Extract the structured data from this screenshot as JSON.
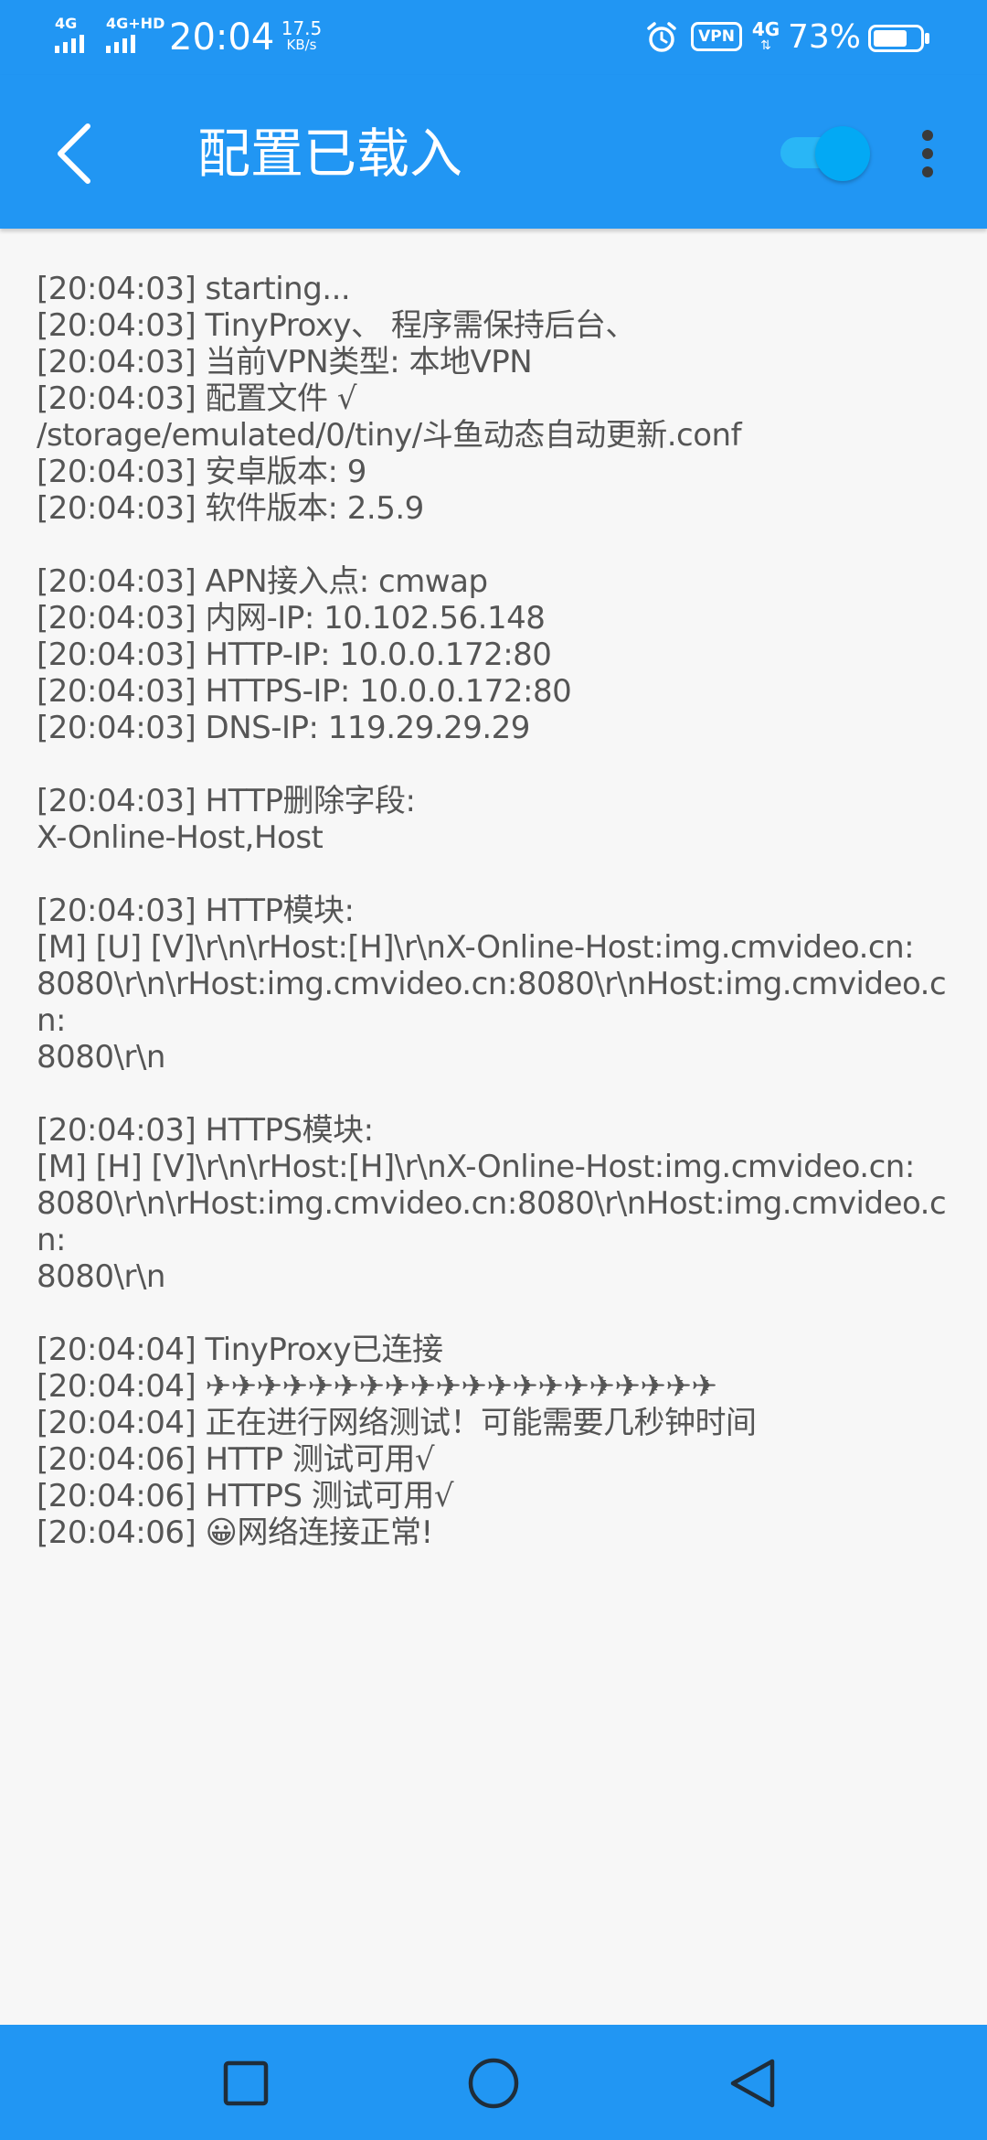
{
  "status_bar": {
    "network_left_1": "4G",
    "network_left_2": "4G+HD",
    "time": "20:04",
    "speed_value": "17.5",
    "speed_unit": "KB/s",
    "vpn_label": "VPN",
    "network_right": "4G",
    "battery_percent": "73%",
    "battery_level": 0.73
  },
  "app_bar": {
    "title": "配置已载入",
    "toggle_on": true
  },
  "log_text": "[20:04:03] starting...\n[20:04:03] TinyProxy、 程序需保持后台、\n[20:04:03] 当前VPN类型: 本地VPN\n[20:04:03] 配置文件 √\n/storage/emulated/0/tiny/斗鱼动态自动更新.conf\n[20:04:03] 安卓版本: 9\n[20:04:03] 软件版本: 2.5.9\n\n[20:04:03] APN接入点: cmwap\n[20:04:03] 内网-IP: 10.102.56.148\n[20:04:03] HTTP-IP: 10.0.0.172:80\n[20:04:03] HTTPS-IP: 10.0.0.172:80\n[20:04:03] DNS-IP: 119.29.29.29\n\n[20:04:03] HTTP删除字段:\nX-Online-Host,Host\n\n[20:04:03] HTTP模块:\n[M] [U] [V]\\r\\n\\rHost:[H]\\r\\nX-Online-Host:img.cmvideo.cn:\n8080\\r\\n\\rHost:img.cmvideo.cn:8080\\r\\nHost:img.cmvideo.cn:\n8080\\r\\n\n\n[20:04:03] HTTPS模块:\n[M] [H] [V]\\r\\n\\rHost:[H]\\r\\nX-Online-Host:img.cmvideo.cn:\n8080\\r\\n\\rHost:img.cmvideo.cn:8080\\r\\nHost:img.cmvideo.cn:\n8080\\r\\n\n\n[20:04:04] TinyProxy已连接\n[20:04:04] ✈✈✈✈✈✈✈✈✈✈✈✈✈✈✈✈✈✈✈✈\n[20:04:04] 正在进行网络测试！可能需要几秒钟时间\n[20:04:06] HTTP 测试可用√\n[20:04:06] HTTPS 测试可用√\n[20:04:06] 😀网络连接正常!",
  "nav_bar": {
    "recent_icon": "square-icon",
    "home_icon": "circle-icon",
    "back_icon": "triangle-back-icon"
  },
  "colors": {
    "primary": "#2196f3",
    "toggle": "#03a9f4",
    "background": "#f7f7f7",
    "log_text": "#555555"
  }
}
